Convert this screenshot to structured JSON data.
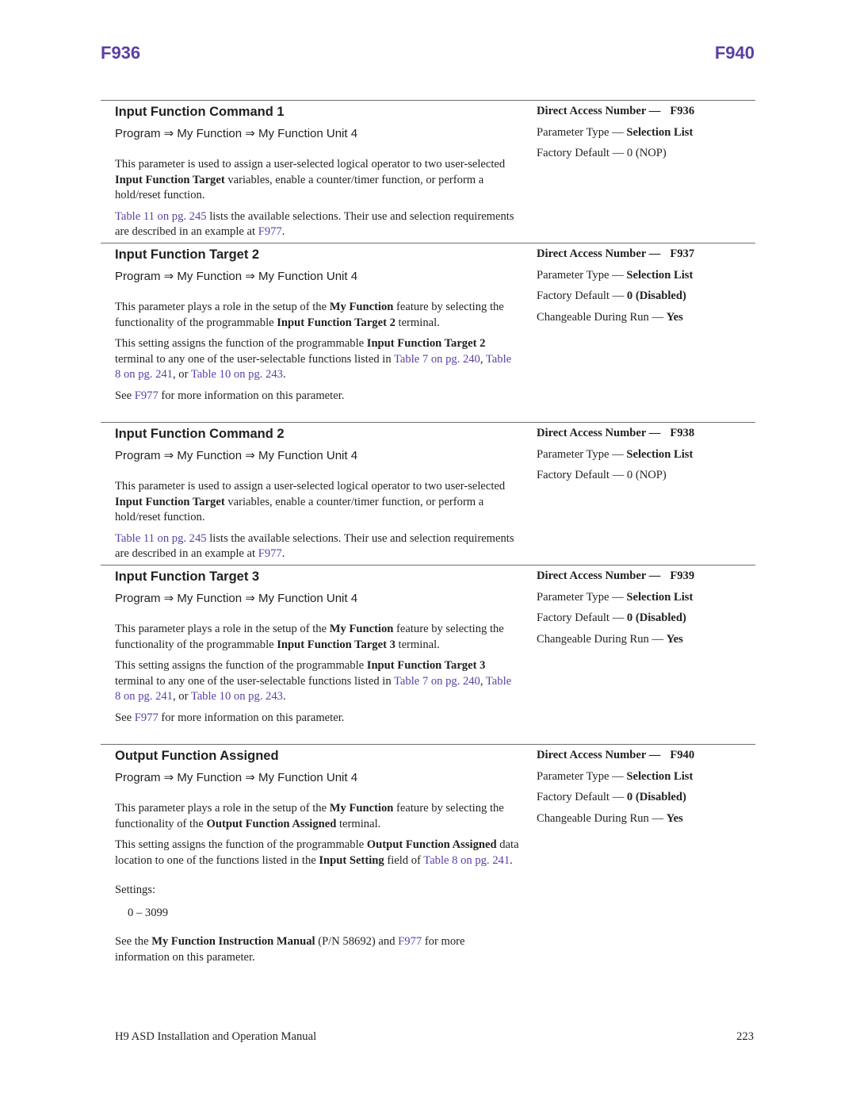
{
  "header": {
    "left_code": "F936",
    "right_code": "F940"
  },
  "colors": {
    "accent": "#5b3fa5",
    "text": "#231f20",
    "rule": "#6d6e71"
  },
  "labels": {
    "direct_access": "Direct Access Number —",
    "parameter_type": "Parameter Type — ",
    "factory_default": "Factory Default — ",
    "changeable": "Changeable During Run — "
  },
  "sections": [
    {
      "title": "Input Function Command 1",
      "path": "Program ⇒ My Function ⇒ My Function Unit 4",
      "p1": {
        "a": "This parameter is used to assign a user-selected logical operator to two user-selected ",
        "b": "Input Function Target",
        "c": " variables, enable a counter/timer function, or perform a hold/reset function."
      },
      "p2": {
        "link1": "Table 11 on pg. 245",
        "a": " lists the available selections. Their use and selection requirements are described in an example at ",
        "link2": "F977",
        "b": "."
      },
      "dan": "F936",
      "type": "Selection List",
      "default": "0 (NOP)"
    },
    {
      "title": "Input Function Target 2",
      "path": "Program ⇒ My Function ⇒ My Function Unit 4",
      "p1": {
        "a": "This parameter plays a role in the setup of the ",
        "b": "My Function",
        "c": " feature by selecting the functionality of the programmable ",
        "d": "Input Function Target 2",
        "e": " terminal."
      },
      "p2": {
        "a": "This setting assigns the function of the programmable ",
        "b": "Input Function Target 2",
        "c": " terminal to any one of the user-selectable functions listed in ",
        "link1": "Table 7 on pg. 240",
        "d": ", ",
        "link2": "Table 8 on pg. 241",
        "e": ", or ",
        "link3": "Table 10 on pg. 243",
        "f": "."
      },
      "p3": {
        "a": "See ",
        "link": "F977",
        "b": " for more information on this parameter."
      },
      "dan": "F937",
      "type": "Selection List",
      "default": "0 (Disabled)",
      "changeable": "Yes"
    },
    {
      "title": "Input Function Command 2",
      "path": "Program ⇒ My Function ⇒ My Function Unit 4",
      "p1": {
        "a": "This parameter is used to assign a user-selected logical operator to two user-selected ",
        "b": "Input Function Target",
        "c": " variables, enable a counter/timer function, or perform a hold/reset function."
      },
      "p2": {
        "link1": "Table 11 on pg. 245",
        "a": " lists the available selections. Their use and selection requirements are described in an example at ",
        "link2": "F977",
        "b": "."
      },
      "dan": "F938",
      "type": "Selection List",
      "default": "0 (NOP)"
    },
    {
      "title": "Input Function Target 3",
      "path": "Program ⇒ My Function ⇒ My Function Unit 4",
      "p1": {
        "a": "This parameter plays a role in the setup of the ",
        "b": "My Function",
        "c": " feature by selecting the functionality of the programmable ",
        "d": "Input Function Target 3",
        "e": " terminal."
      },
      "p2": {
        "a": "This setting assigns the function of the programmable ",
        "b": "Input Function Target 3",
        "c": " terminal to any one of the user-selectable functions listed in ",
        "link1": "Table 7 on pg. 240",
        "d": ", ",
        "link2": "Table 8 on pg. 241",
        "e": ", or ",
        "link3": "Table 10 on pg. 243",
        "f": "."
      },
      "p3": {
        "a": "See ",
        "link": "F977",
        "b": " for more information on this parameter."
      },
      "dan": "F939",
      "type": "Selection List",
      "default": "0 (Disabled)",
      "changeable": "Yes"
    },
    {
      "title": "Output Function Assigned",
      "path": "Program ⇒ My Function ⇒ My Function Unit 4",
      "p1": {
        "a": "This parameter plays a role in the setup of the ",
        "b": "My Function",
        "c": " feature by selecting the functionality of the ",
        "d": "Output Function Assigned",
        "e": " terminal."
      },
      "p2": {
        "a": "This setting assigns the function of the programmable ",
        "b": "Output Function Assigned",
        "c": " data location to one of the functions listed in the ",
        "d": "Input Setting",
        "e": " field of ",
        "link1": "Table 8 on pg. 241",
        "f": "."
      },
      "settings_label": "Settings:",
      "settings_value": "0 – 3099",
      "p3": {
        "a": "See the ",
        "b": "My Function Instruction Manual",
        "c": " (P/N 58692) and ",
        "link": "F977",
        "d": " for more information on this parameter."
      },
      "dan": "F940",
      "type": "Selection List",
      "default": "0 (Disabled)",
      "changeable": "Yes"
    }
  ],
  "footer": {
    "manual_title": "H9 ASD Installation and Operation Manual",
    "page_number": "223"
  }
}
